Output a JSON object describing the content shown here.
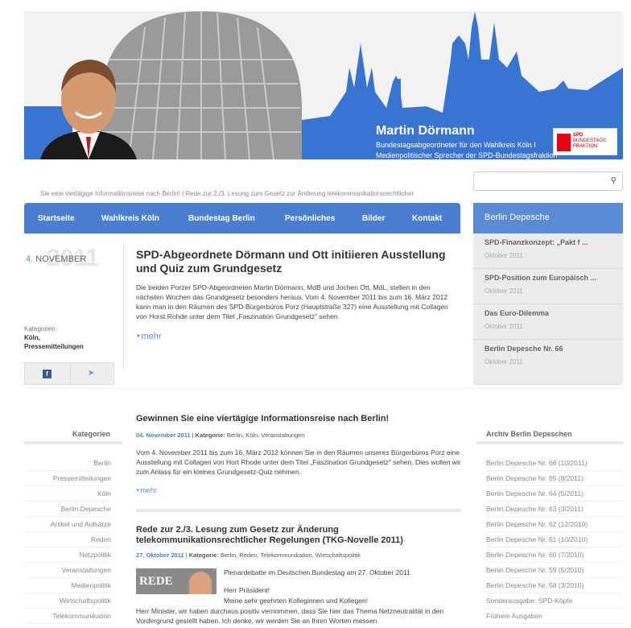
{
  "header": {
    "name": "Martin Dörmann",
    "subtitle_line1": "Bundestagsabgeordneter für den Wahlkreis Köln I",
    "subtitle_line2": "Medienpolitischer Sprecher der SPD-Bundestagsfraktion",
    "logo_line1": "SPD",
    "logo_line2": "BUNDESTAGS",
    "logo_line3": "FRAKTION"
  },
  "ticker": "Sie eine viertägige Informationsreise nach Berlin!  |  Rede zur 2./3. Lesung zum Gesetz zur Änderung telekommunikationsrechtlicher",
  "search": {
    "placeholder": "",
    "icon": "search-icon"
  },
  "nav": [
    "Startseite",
    "Wahlkreis Köln",
    "Bundestag Berlin",
    "Persönliches",
    "Bilder",
    "Kontakt"
  ],
  "berlin_depesche": {
    "title": "Berlin Depesche",
    "items": [
      {
        "title": "SPD-Finanzkonzept: „Pakt f ...",
        "date": "Oktober 2011"
      },
      {
        "title": "SPD-Position zum Europäisch ...",
        "date": "Oktober 2011"
      },
      {
        "title": "Das Euro-Dilemma",
        "date": "Oktober 2011"
      },
      {
        "title": "Berlin Depesche Nr. 66",
        "date": "Oktober 2011"
      }
    ]
  },
  "featured": {
    "day": "4.",
    "month": "NOVEMBER",
    "year": "2011",
    "kategorien_label": "Kategorien:",
    "kategorien_line1": "Köln,",
    "kategorien_line2": "Pressemitteilungen",
    "title": "SPD-Abgeordnete Dörmann und Ott initiieren Ausstellung und Quiz zum Grundgesetz",
    "text": "Die beiden Porzer SPD-Abgeordneten Martin Dörmann, MdB und Jochen Ott, MdL, stellen in den nächsten Wochen das Grundgesetz besonders heraus. Vom 4. November 2011 bis zum 16. März 2012 kann man in den Räumen des SPD-Bürgerbüros Porz (Hauptstraße 327) eine Ausstellung mit Collagen von Horst Rohde unter dem Titel „Faszination Grundgesetz\" sehen.",
    "more": "mehr"
  },
  "kategorien": {
    "title": "Kategorien",
    "items": [
      "Berlin",
      "Pressemitteilungen",
      "Köln",
      "Berlin Depesche",
      "Artikel und Aufsätze",
      "Reden",
      "Netzpolitik",
      "Veranstaltungen",
      "Medienpolitik",
      "Wirtschaftspolitik",
      "Telekommunikation"
    ]
  },
  "archiv": {
    "title": "Archiv Berlin Depeschen",
    "items": [
      "Berlin Depesche Nr. 66 (10/2011)",
      "Berlin Depesche Nr. 65 (8/2011)",
      "Berlin Depesche Nr. 64 (5/2011)",
      "Berlin Depesche Nr. 63 (3/2011)",
      "Berlin Depesche Nr. 62 (12/2010)",
      "Berlin Depesche Nr. 61 (10/2010)",
      "Berlin Depesche Nr. 60 (7/2010)",
      "Berlin Depesche Nr. 59 (5/2010)",
      "Berlin Depesche Nr. 58 (3/2010)",
      "Sonderausgabe: SPD-Köpfe",
      "Frühere Ausgaben"
    ]
  },
  "articles": [
    {
      "title": "Gewinnen Sie eine viertägige Informationsreise nach Berlin!",
      "date": "04. November 2011",
      "kat_label": "Kategorie:",
      "kats": "Berlin, Köln, Veranstaltungen",
      "text": "Vom 4. November 2011 bis zum 16. März 2012 können Sie in den Räumen unseres Bürgerbüros Porz eine Ausstellung mit Collagen von Hort Rhode unter dem Titel „Faszination Grundgesetz\" sehen. Dies wollen wir zum Anlass für ein kleines Grundgesetz-Quiz nehmen.",
      "more": "mehr"
    },
    {
      "title_line1": "Rede zur 2./3. Lesung zum Gesetz zur Änderung",
      "title_line2": "telekommunikationsrechtlicher Regelungen (TKG-Novelle 2011)",
      "date": "27. Oktober 2011",
      "kat_label": "Kategorie:",
      "kats": "Berlin, Reden, Telekommunikation, Wirtschaftspolitik",
      "img_label": "REDE",
      "line1": "Plenardebatte im Deutschen Bundestag am 27. Oktober 2011",
      "line2": "Herr Präsident!",
      "line3": "Meine sehr geehrten Kolleginnen und Kollegen!",
      "text": "Herr Minister, wir haben durchaus positiv vernommen, dass Sie hier das Thema Netzneutralität in den Vordergrund gestellt haben. Ich denke, wir werden Sie an Ihren Worten messen."
    }
  ],
  "colors": {
    "accent": "#4a7fcf",
    "header_sky": "#f0f0f0",
    "header_city": "#3a74d1"
  }
}
